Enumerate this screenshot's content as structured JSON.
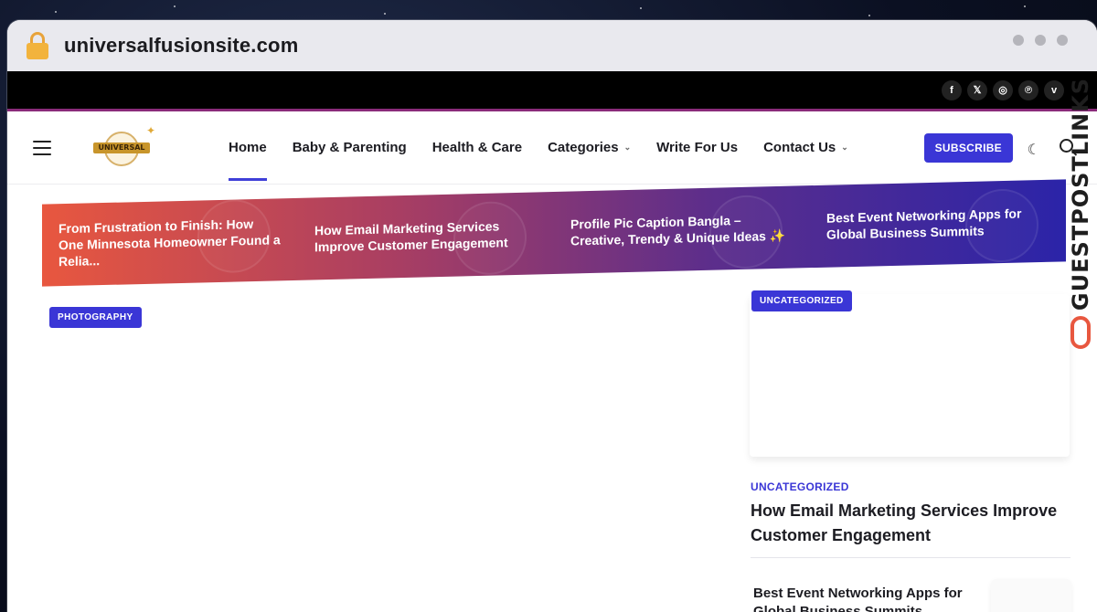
{
  "browser": {
    "url": "universalfusionsite.com"
  },
  "social": [
    "f",
    "𝕏",
    "◎",
    "℗",
    "v"
  ],
  "nav": {
    "items": [
      {
        "label": "Home",
        "active": true,
        "dropdown": false
      },
      {
        "label": "Baby & Parenting",
        "active": false,
        "dropdown": false
      },
      {
        "label": "Health & Care",
        "active": false,
        "dropdown": false
      },
      {
        "label": "Categories",
        "active": false,
        "dropdown": true
      },
      {
        "label": "Write For Us",
        "active": false,
        "dropdown": false
      },
      {
        "label": "Contact Us",
        "active": false,
        "dropdown": true
      }
    ],
    "subscribe": "SUBSCRIBE",
    "logo_text": "UNIVERSAL"
  },
  "ticker": [
    "From Frustration to Finish: How One Minnesota Homeowner Found a Relia...",
    "How Email Marketing Services Improve Customer Engagement",
    "Profile Pic Caption Bangla – Creative, Trendy & Unique Ideas ✨",
    "Best Event Networking Apps for Global Business Summits"
  ],
  "main": {
    "badge": "PHOTOGRAPHY"
  },
  "sidebar": {
    "badge": "UNCATEGORIZED",
    "category": "UNCATEGORIZED",
    "title": "How Email Marketing Services Improve Customer Engagement",
    "small_title": "Best Event Networking Apps for Global Business Summits"
  },
  "watermark": "GUESTPOSTLINKS",
  "colors": {
    "accent": "#3a36d6",
    "gradient_start": "#e8573f",
    "gradient_end": "#2b24a8"
  }
}
